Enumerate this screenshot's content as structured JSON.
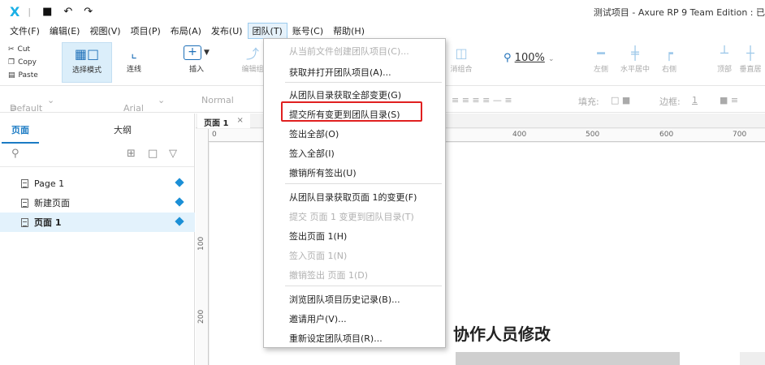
{
  "titlebar": {
    "logo": "X",
    "app_title": "测试项目 - Axure RP 9 Team Edition : 已"
  },
  "menubar": {
    "items": [
      "文件(F)",
      "编辑(E)",
      "视图(V)",
      "项目(P)",
      "布局(A)",
      "发布(U)",
      "团队(T)",
      "账号(C)",
      "帮助(H)"
    ]
  },
  "ribbon": {
    "cut": "Cut",
    "copy": "Copy",
    "paste": "Paste",
    "select_mode": "选择模式",
    "connect": "连线",
    "insert": "插入",
    "edit_partial": "编辑组",
    "group_partial": "消组合",
    "zoom": "100%",
    "align_left": "左侧",
    "align_center": "水平居中",
    "align_right": "右侧",
    "align_top": "顶部",
    "align_middle": "垂直居"
  },
  "stylebar": {
    "style": "Default",
    "font": "Arial",
    "weight": "Normal",
    "fill_label": "填充:",
    "border_label": "边框:",
    "border_value": "1"
  },
  "left_panel": {
    "tab_pages": "页面",
    "tab_outline": "大纲",
    "pages": [
      "Page 1",
      "新建页面",
      "页面 1"
    ]
  },
  "canvas": {
    "tab_label": "页面 1",
    "tab_close": "×",
    "ruler_h": [
      "0",
      "400",
      "500",
      "600",
      "700"
    ],
    "ruler_v": [
      "100",
      "200"
    ],
    "heading": "协作人员修改"
  },
  "team_menu": {
    "items": [
      {
        "label": "从当前文件创建团队项目(C)...",
        "disabled": true
      },
      {
        "label": "获取并打开团队项目(A)...",
        "disabled": false
      },
      {
        "label": "从团队目录获取全部变更(G)",
        "disabled": false
      },
      {
        "label": "提交所有变更到团队目录(S)",
        "disabled": false
      },
      {
        "label": "签出全部(O)",
        "disabled": false
      },
      {
        "label": "签入全部(I)",
        "disabled": false
      },
      {
        "label": "撤销所有签出(U)",
        "disabled": false
      },
      {
        "label": "从团队目录获取页面  1的变更(F)",
        "disabled": false
      },
      {
        "label": "提交 页面 1 变更到团队目录(T)",
        "disabled": true
      },
      {
        "label": "签出页面 1(H)",
        "disabled": false
      },
      {
        "label": "签入页面 1(N)",
        "disabled": true
      },
      {
        "label": "撤销签出 页面 1(D)",
        "disabled": true
      },
      {
        "label": "浏览团队项目历史记录(B)...",
        "disabled": false
      },
      {
        "label": "邀请用户(V)...",
        "disabled": false
      },
      {
        "label": "重新设定团队项目(R)...",
        "disabled": false
      }
    ]
  },
  "colors": {
    "accent": "#1b7bc4",
    "highlight_box": "#e02020",
    "menu_active_bg": "#e6f2fb"
  }
}
